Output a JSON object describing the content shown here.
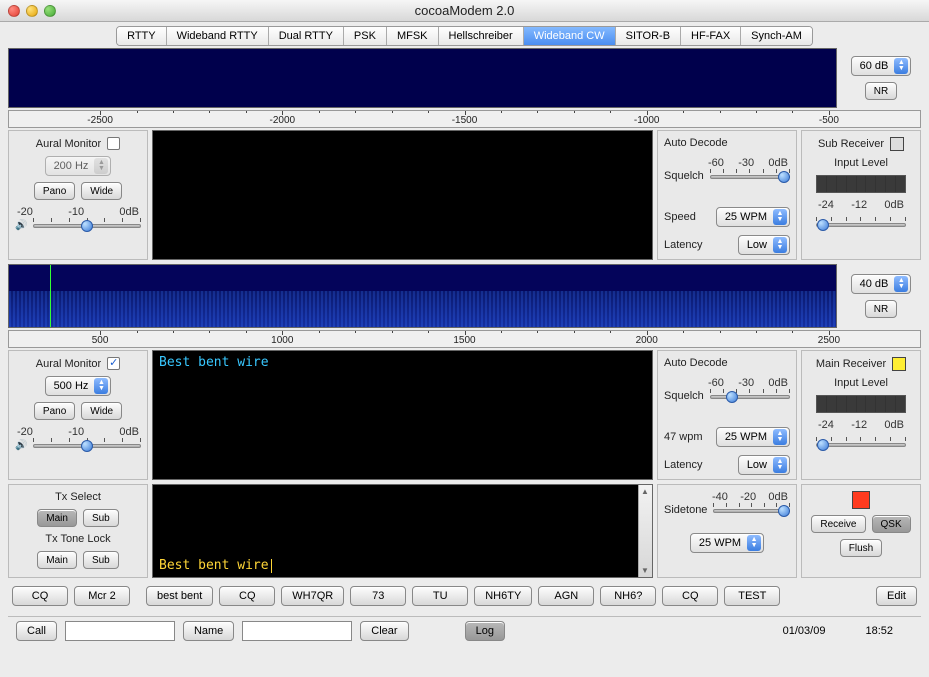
{
  "window": {
    "title": "cocoaModem 2.0"
  },
  "tabs": [
    "RTTY",
    "Wideband RTTY",
    "Dual RTTY",
    "PSK",
    "MFSK",
    "Hellschreiber",
    "Wideband CW",
    "SITOR-B",
    "HF-FAX",
    "Synch-AM"
  ],
  "active_tab": "Wideband CW",
  "ruler_top": [
    "-2500",
    "-2000",
    "-1500",
    "-1000",
    "-500"
  ],
  "ruler_bottom": [
    "500",
    "1000",
    "1500",
    "2000",
    "2500"
  ],
  "right_mini_top": {
    "gain": "60 dB",
    "nr": "NR"
  },
  "right_mini_bottom": {
    "gain": "40 dB",
    "nr": "NR"
  },
  "sub": {
    "aural_label": "Aural Monitor",
    "aural_checked": false,
    "filter": "200 Hz",
    "pano": "Pano",
    "wide": "Wide",
    "vol_labels": [
      "-20",
      "-10",
      "0dB"
    ],
    "decode_label": "Auto Decode",
    "squelch_label": "Squelch",
    "squelch_labels": [
      "-60",
      "-30",
      "0dB"
    ],
    "speed_label": "Speed",
    "speed": "25 WPM",
    "latency_label": "Latency",
    "latency": "Low",
    "rx_label": "Sub Receiver",
    "input_label": "Input Level",
    "level_labels": [
      "-24",
      "-12",
      "0dB"
    ]
  },
  "main_rx": {
    "aural_label": "Aural Monitor",
    "aural_checked": true,
    "filter": "500 Hz",
    "pano": "Pano",
    "wide": "Wide",
    "vol_labels": [
      "-20",
      "-10",
      "0dB"
    ],
    "decoded_text": "Best bent wire",
    "decode_label": "Auto Decode",
    "squelch_label": "Squelch",
    "squelch_labels": [
      "-60",
      "-30",
      "0dB"
    ],
    "wpm_readout": "47 wpm",
    "speed": "25 WPM",
    "latency_label": "Latency",
    "latency": "Low",
    "rx_label": "Main Receiver",
    "input_label": "Input Level",
    "level_labels": [
      "-24",
      "-12",
      "0dB"
    ]
  },
  "tx": {
    "select_label": "Tx Select",
    "main_btn": "Main",
    "sub_btn": "Sub",
    "tone_lock_label": "Tx Tone Lock",
    "buffer_text": "Best bent wire",
    "sidetone_label": "Sidetone",
    "sidetone_labels": [
      "-40",
      "-20",
      "0dB"
    ],
    "speed": "25 WPM",
    "receive": "Receive",
    "qsk": "QSK",
    "flush": "Flush"
  },
  "macros": {
    "left": [
      "CQ",
      "Mcr 2"
    ],
    "mid": [
      "best bent",
      "CQ",
      "WH7QR",
      "73",
      "TU",
      "NH6TY",
      "AGN",
      "NH6?",
      "CQ",
      "TEST"
    ],
    "edit": "Edit"
  },
  "status": {
    "call_label": "Call",
    "name_label": "Name",
    "clear": "Clear",
    "log": "Log",
    "date": "01/03/09",
    "time": "18:52"
  }
}
